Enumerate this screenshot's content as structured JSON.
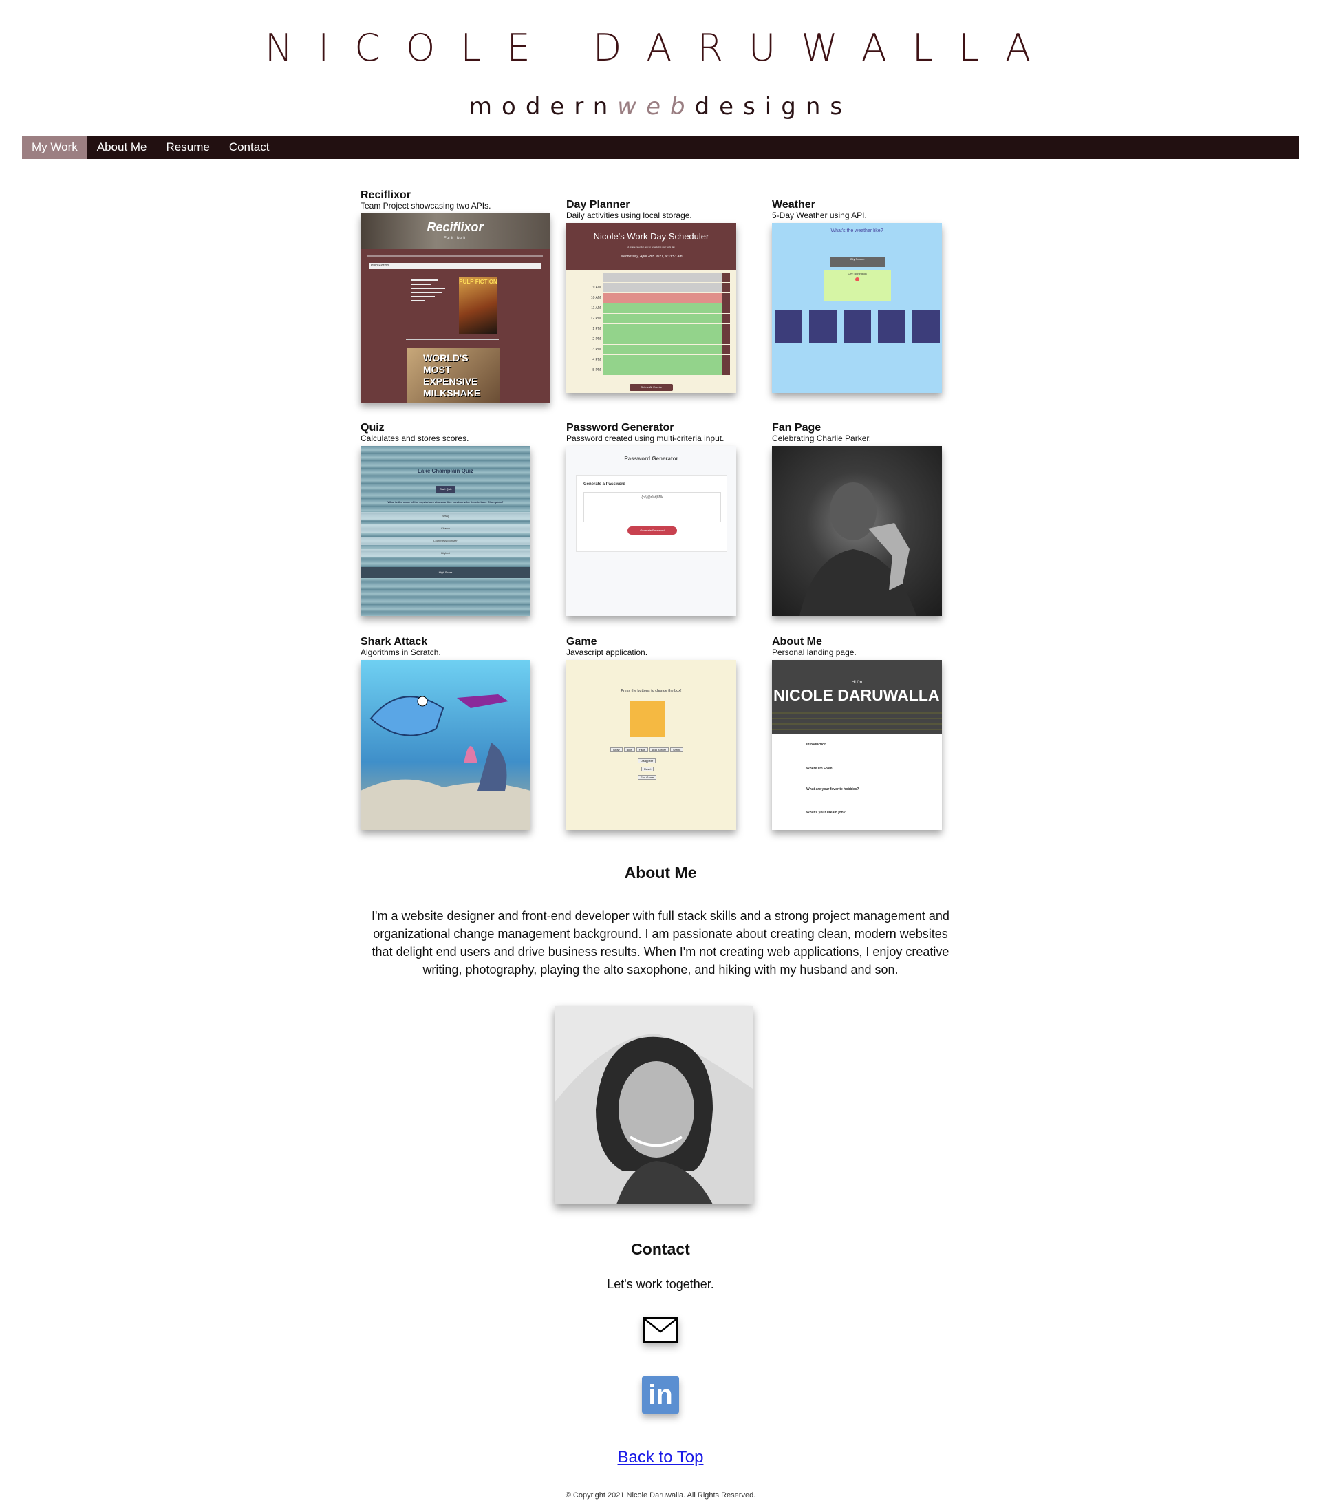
{
  "header": {
    "name": "NICOLE DARUWALLA",
    "tagline_modern": "modern",
    "tagline_web": "web",
    "tagline_designs": "designs"
  },
  "nav": {
    "items": [
      {
        "label": "My Work",
        "active": true
      },
      {
        "label": "About Me",
        "active": false
      },
      {
        "label": "Resume",
        "active": false
      },
      {
        "label": "Contact",
        "active": false
      }
    ]
  },
  "projects": [
    {
      "title": "Reciflixor",
      "desc": "Team Project showcasing two APIs.",
      "thumb_title": "Reciflixor",
      "thumb_sub": "Eat It Like It!",
      "thumb_search": "Pulp Fiction",
      "thumb_poster": "PULP FICTION",
      "thumb_banner": "WORLD'S MOST EXPENSIVE MILKSHAKE"
    },
    {
      "title": "Day Planner",
      "desc": "Daily activities using local storage.",
      "thumb_title": "Nicole's Work Day Scheduler",
      "thumb_sub": "A simple calendar app for scheduling your work day",
      "thumb_date": "Wednesday, April 28th 2021, 9:33:53 am",
      "hours": [
        "9 AM",
        "10 AM",
        "11 AM",
        "12 PM",
        "1 PM",
        "2 PM",
        "3 PM",
        "4 PM",
        "5 PM"
      ],
      "thumb_save": "Delete All Events"
    },
    {
      "title": "Weather",
      "desc": "5-Day Weather using API.",
      "thumb_title": "What's the weather like?",
      "thumb_search": "City Search",
      "thumb_city": "City: Burlington"
    },
    {
      "title": "Quiz",
      "desc": "Calculates and stores scores.",
      "thumb_title": "Lake Champlain Quiz",
      "thumb_start": "Start Quiz",
      "thumb_question": "What is the name of the mysterious dinosaur-like creature who lives in Lake Champlain?",
      "thumb_answers": [
        "Nessy",
        "Champ",
        "Loch Ness Monster",
        "Bigfoot"
      ],
      "thumb_footer": "High Score"
    },
    {
      "title": "Password Generator",
      "desc": "Password created using multi-criteria input.",
      "thumb_title": "Password Generator",
      "thumb_sub": "Generate a Password",
      "thumb_pw": "{h5j@r%t]8Nk",
      "thumb_button": "Generate Password"
    },
    {
      "title": "Fan Page",
      "desc": "Celebrating Charlie Parker."
    },
    {
      "title": "Shark Attack",
      "desc": "Algorithms in Scratch."
    },
    {
      "title": "Game",
      "desc": "Javascript application.",
      "thumb_title": "Press the buttons to change the box!",
      "thumb_buttons": [
        "Grow",
        "Blue",
        "Fade",
        "Add Border",
        "Shrink"
      ],
      "thumb_disappear": "Disappear",
      "thumb_reset": "Reset",
      "thumb_end": "End Game"
    },
    {
      "title": "About Me",
      "desc": "Personal landing page.",
      "thumb_hi": "Hi I'm",
      "thumb_name": "NICOLE DARUWALLA",
      "thumb_sections": [
        "Introduction",
        "Where I'm From",
        "What are your favorite hobbies?",
        "What's your dream job?"
      ]
    }
  ],
  "about": {
    "heading": "About Me",
    "text": "I'm a website designer and front-end developer with full stack skills and a strong project management and organizational change management background. I am passionate about creating clean, modern websites that delight end users and drive business results. When I'm not creating web applications, I enjoy creative writing, photography, playing the alto saxophone, and hiking with my husband and son."
  },
  "contact": {
    "heading": "Contact",
    "tagline": "Let's work together.",
    "email_icon": "envelope-icon",
    "linkedin_icon": "linkedin-icon",
    "linkedin_text": "in"
  },
  "footer": {
    "back_to_top": "Back to Top",
    "copyright": "© Copyright 2021 Nicole Daruwalla. All Rights Reserved."
  },
  "colors": {
    "nav_bg": "#221011",
    "nav_active": "#9c7f82",
    "name_color": "#3e1215",
    "link": "#1a1ae6"
  }
}
